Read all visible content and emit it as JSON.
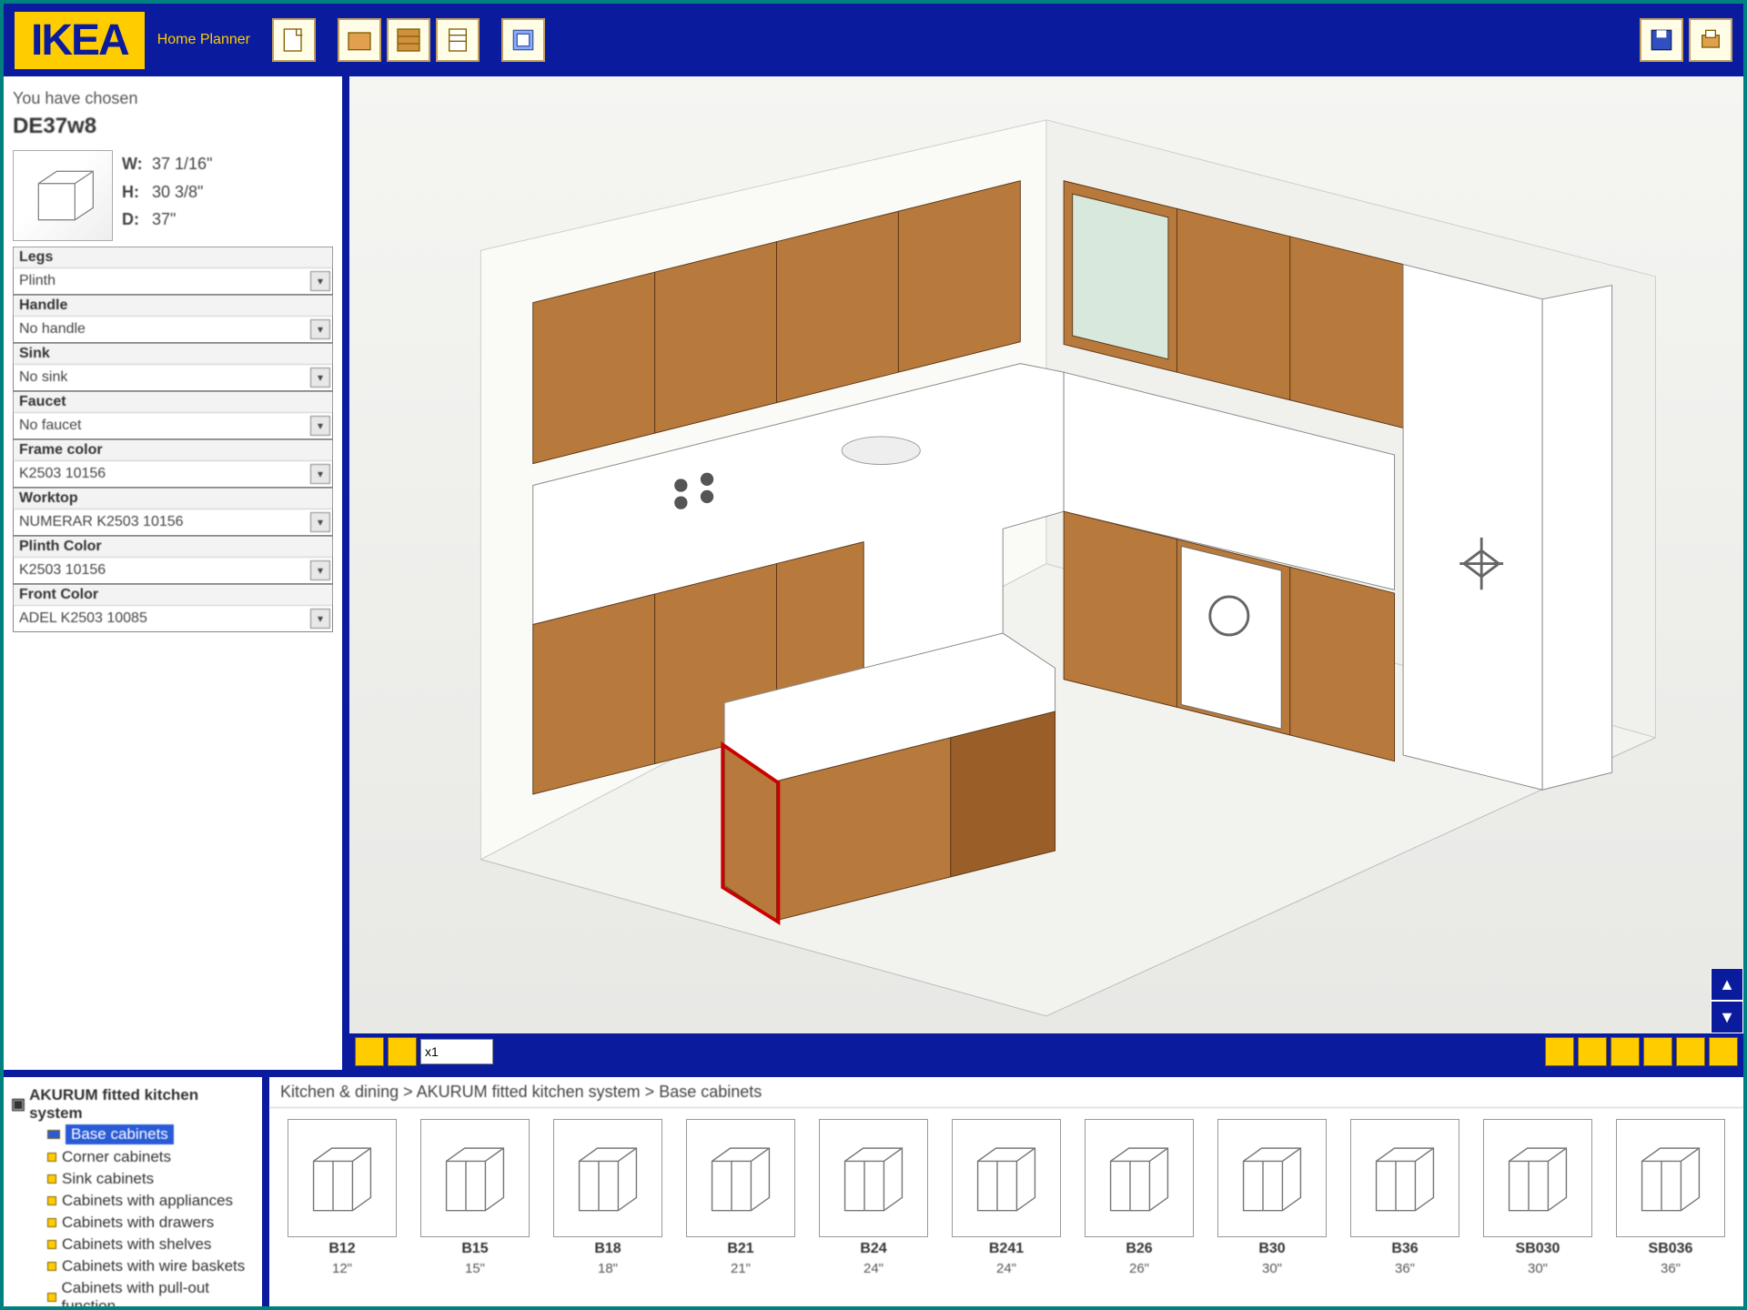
{
  "brand": "IKEA",
  "app_name": "Home Planner",
  "header": {
    "buttons_left": [
      "new",
      "room",
      "doors",
      "windows",
      "items",
      "settings"
    ],
    "buttons_right": [
      "save",
      "print"
    ]
  },
  "selected_item": {
    "chosen_label": "You have chosen",
    "model": "DE37w8",
    "dims": {
      "W": "37 1/16\"",
      "H": "30 3/8\"",
      "D": "37\""
    }
  },
  "properties": [
    {
      "label": "Legs",
      "value": "Plinth"
    },
    {
      "label": "Handle",
      "value": "No handle"
    },
    {
      "label": "Sink",
      "value": "No sink"
    },
    {
      "label": "Faucet",
      "value": "No faucet"
    },
    {
      "label": "Frame color",
      "value": "K2503 10156"
    },
    {
      "label": "Worktop",
      "value": "NUMERAR K2503 10156"
    },
    {
      "label": "Plinth Color",
      "value": "K2503 10156"
    },
    {
      "label": "Front Color",
      "value": "ADEL K2503 10085"
    }
  ],
  "viewport": {
    "zoom_value": "x1",
    "nav_left": [
      "prev",
      "next"
    ],
    "nav_right": [
      "zoom-in",
      "zoom-out",
      "fit",
      "rotate-l",
      "rotate-r",
      "pan"
    ]
  },
  "tree": {
    "root": "AKURUM fitted kitchen system",
    "items": [
      {
        "label": "Base cabinets",
        "selected": true
      },
      {
        "label": "Corner cabinets",
        "selected": false
      },
      {
        "label": "Sink cabinets",
        "selected": false
      },
      {
        "label": "Cabinets with appliances",
        "selected": false
      },
      {
        "label": "Cabinets with drawers",
        "selected": false
      },
      {
        "label": "Cabinets with shelves",
        "selected": false
      },
      {
        "label": "Cabinets with wire baskets",
        "selected": false
      },
      {
        "label": "Cabinets with pull-out function",
        "selected": false
      }
    ]
  },
  "breadcrumb": "Kitchen & dining > AKURUM fitted kitchen system > Base cabinets",
  "catalog": [
    {
      "name": "B12",
      "size": "12\""
    },
    {
      "name": "B15",
      "size": "15\""
    },
    {
      "name": "B18",
      "size": "18\""
    },
    {
      "name": "B21",
      "size": "21\""
    },
    {
      "name": "B24",
      "size": "24\""
    },
    {
      "name": "B241",
      "size": "24\""
    },
    {
      "name": "B26",
      "size": "26\""
    },
    {
      "name": "B30",
      "size": "30\""
    },
    {
      "name": "B36",
      "size": "36\""
    },
    {
      "name": "SB030",
      "size": "30\""
    },
    {
      "name": "SB036",
      "size": "36\""
    }
  ]
}
